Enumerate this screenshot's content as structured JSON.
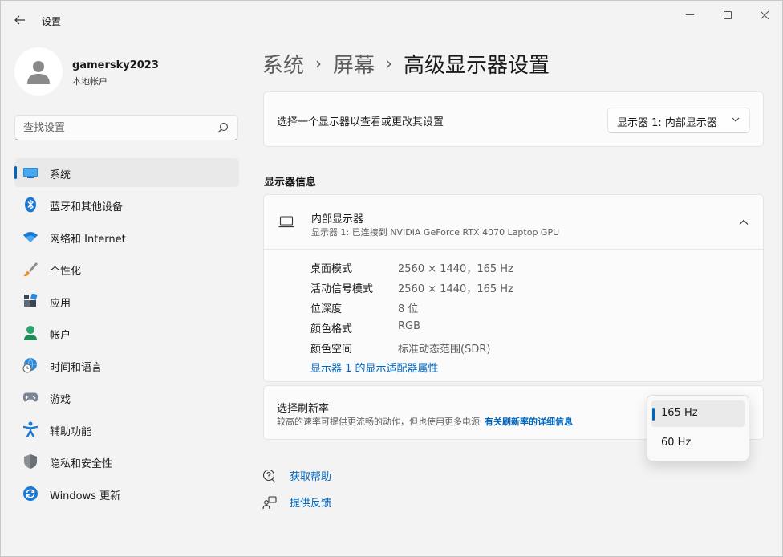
{
  "app": {
    "title": "设置"
  },
  "profile": {
    "name": "gamersky2023",
    "account_type": "本地帐户"
  },
  "search": {
    "placeholder": "查找设置"
  },
  "sidebar": {
    "items": [
      {
        "label": "系统",
        "icon": "monitor-icon",
        "active": true
      },
      {
        "label": "蓝牙和其他设备",
        "icon": "bluetooth-icon"
      },
      {
        "label": "网络和 Internet",
        "icon": "wifi-icon"
      },
      {
        "label": "个性化",
        "icon": "brush-icon"
      },
      {
        "label": "应用",
        "icon": "apps-icon"
      },
      {
        "label": "帐户",
        "icon": "person-icon"
      },
      {
        "label": "时间和语言",
        "icon": "globe-clock-icon"
      },
      {
        "label": "游戏",
        "icon": "gamepad-icon"
      },
      {
        "label": "辅助功能",
        "icon": "accessibility-icon"
      },
      {
        "label": "隐私和安全性",
        "icon": "shield-icon"
      },
      {
        "label": "Windows 更新",
        "icon": "update-icon"
      }
    ]
  },
  "breadcrumb": {
    "level1": "系统",
    "level2": "屏幕",
    "current": "高级显示器设置"
  },
  "display_select": {
    "label": "选择一个显示器以查看或更改其设置",
    "selected": "显示器 1: 内部显示器"
  },
  "display_info": {
    "section_title": "显示器信息",
    "name": "内部显示器",
    "subtitle": "显示器 1: 已连接到 NVIDIA GeForce RTX 4070 Laptop GPU",
    "rows": [
      {
        "key": "桌面模式",
        "value": "2560 × 1440，165 Hz"
      },
      {
        "key": "活动信号模式",
        "value": "2560 × 1440，165 Hz"
      },
      {
        "key": "位深度",
        "value": "8 位"
      },
      {
        "key": "颜色格式",
        "value": "RGB"
      },
      {
        "key": "颜色空间",
        "value": "标准动态范围(SDR)"
      }
    ],
    "adapter_link": "显示器 1 的显示适配器属性"
  },
  "refresh": {
    "title": "选择刷新率",
    "description": "较高的速率可提供更流畅的动作，但也使用更多电源",
    "link": "有关刷新率的详细信息",
    "options": [
      "165 Hz",
      "60 Hz"
    ],
    "selected": "165 Hz"
  },
  "help": {
    "get_help": "获取帮助",
    "feedback": "提供反馈"
  },
  "colors": {
    "accent": "#0067c0"
  }
}
